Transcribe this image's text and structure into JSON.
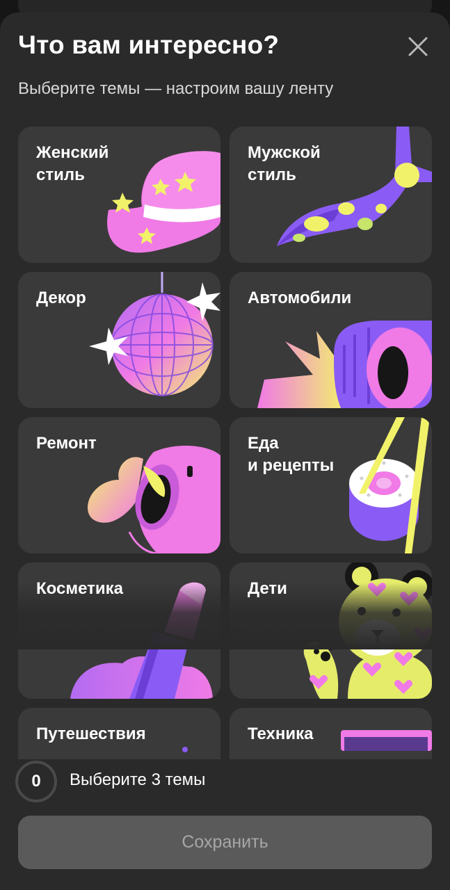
{
  "header": {
    "title": "Что вам интересно?",
    "subtitle": "Выберите темы — настроим вашу ленту",
    "close_icon": "close-icon"
  },
  "topics": [
    {
      "label": "Женский\nстиль",
      "illustration": "hat-icon"
    },
    {
      "label": "Мужской\nстиль",
      "illustration": "tie-icon"
    },
    {
      "label": "Декор",
      "illustration": "disco-ball-icon"
    },
    {
      "label": "Автомобили",
      "illustration": "tire-icon"
    },
    {
      "label": "Ремонт",
      "illustration": "paint-bucket-icon"
    },
    {
      "label": "Еда\nи рецепты",
      "illustration": "sushi-icon"
    },
    {
      "label": "Косметика",
      "illustration": "lipstick-icon"
    },
    {
      "label": "Дети",
      "illustration": "teddy-bear-icon"
    },
    {
      "label": "Путешествия",
      "illustration": "travel-icon"
    },
    {
      "label": "Техника",
      "illustration": "device-icon"
    }
  ],
  "footer": {
    "selected_count": "0",
    "hint": "Выберите 3 темы",
    "save_label": "Сохранить"
  },
  "colors": {
    "sheet_bg": "#2a2a2a",
    "card_bg": "#3a3a3a",
    "pink": "#f07ae6",
    "purple": "#8a5cf5",
    "yellow": "#f2f26a",
    "button_disabled": "#5a5a5a"
  }
}
